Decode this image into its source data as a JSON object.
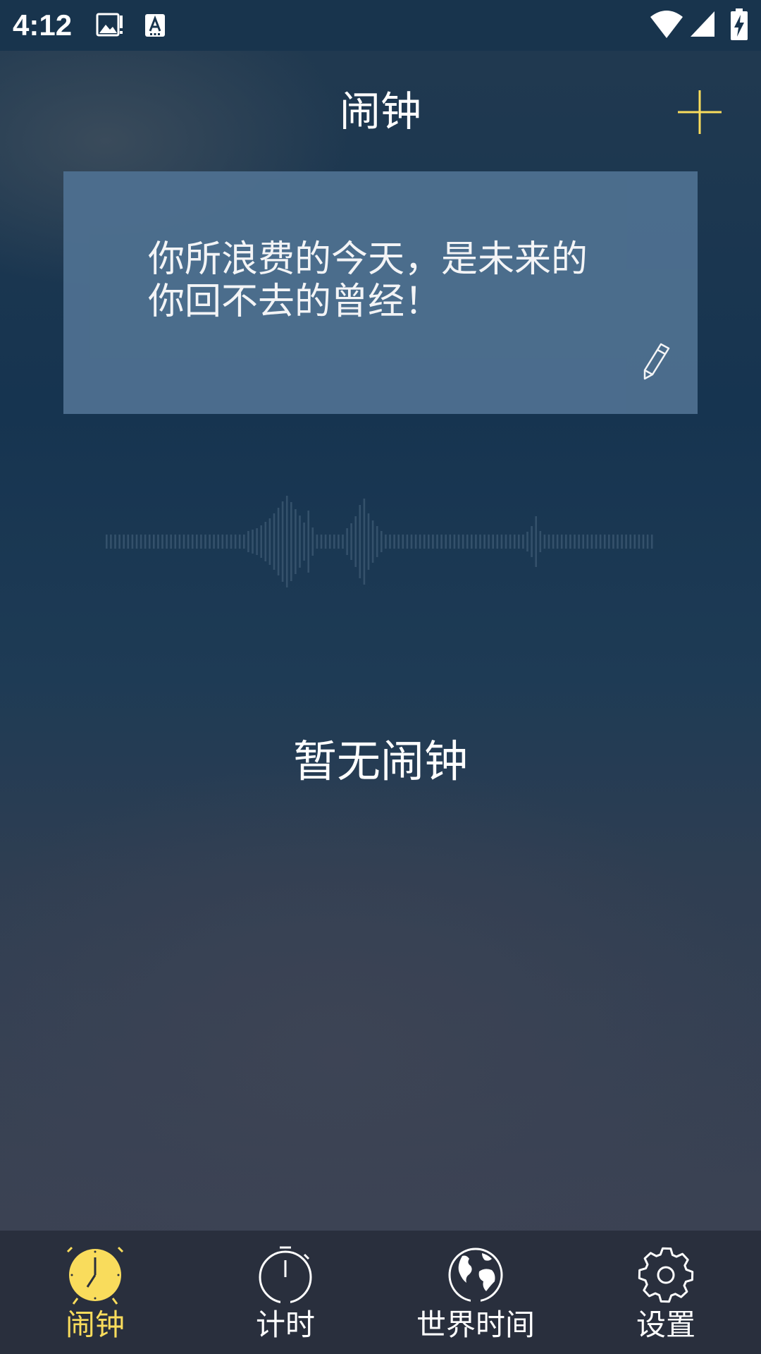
{
  "status_bar": {
    "time": "4:12",
    "icons": [
      "gallery-notification-icon",
      "keyboard-notification-icon",
      "wifi-icon",
      "cell-signal-icon",
      "battery-charging-icon"
    ]
  },
  "header": {
    "title": "闹钟",
    "add_icon": "plus-icon"
  },
  "quote_card": {
    "text": "你所浪费的今天，是未来的\n你回不去的曾经！",
    "edit_icon": "pencil-icon"
  },
  "main": {
    "empty_text": "暂无闹钟"
  },
  "bottom_nav": {
    "items": [
      {
        "label": "闹钟",
        "icon": "alarm-clock-icon",
        "active": true
      },
      {
        "label": "计时",
        "icon": "stopwatch-icon",
        "active": false
      },
      {
        "label": "世界时间",
        "icon": "globe-icon",
        "active": false
      },
      {
        "label": "设置",
        "icon": "gear-icon",
        "active": false
      }
    ]
  },
  "colors": {
    "accent": "#f9dc5c",
    "nav_background": "#292f3d",
    "card_background": "#4e7090",
    "status_bar": "#18344d"
  }
}
